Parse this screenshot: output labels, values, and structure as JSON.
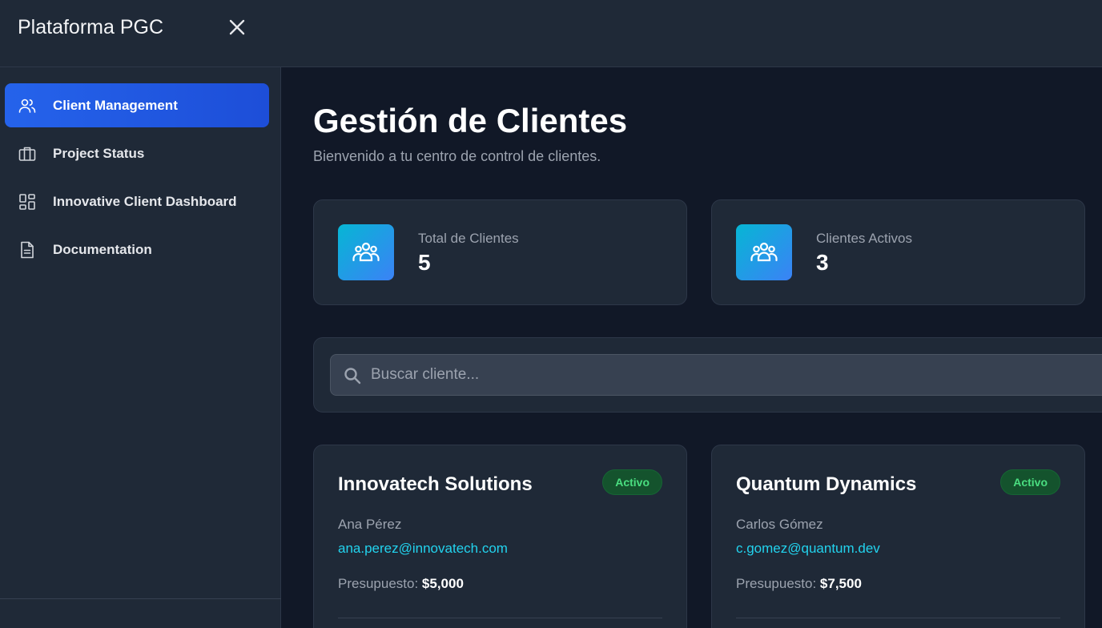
{
  "app": {
    "title": "Plataforma PGC"
  },
  "sidebar": {
    "items": [
      {
        "label": "Client Management",
        "icon": "users-icon",
        "active": true
      },
      {
        "label": "Project Status",
        "icon": "briefcase-icon",
        "active": false
      },
      {
        "label": "Innovative Client Dashboard",
        "icon": "dashboard-grid-icon",
        "active": false
      },
      {
        "label": "Documentation",
        "icon": "document-icon",
        "active": false
      }
    ]
  },
  "main": {
    "title": "Gestión de Clientes",
    "subtitle": "Bienvenido a tu centro de control de clientes.",
    "stats": [
      {
        "label": "Total de Clientes",
        "value": "5",
        "icon": "users-group-icon"
      },
      {
        "label": "Clientes Activos",
        "value": "3",
        "icon": "users-group-icon"
      }
    ],
    "search": {
      "placeholder": "Buscar cliente...",
      "value": ""
    },
    "clients": [
      {
        "name": "Innovatech Solutions",
        "status": "Activo",
        "contact": "Ana Pérez",
        "email": "ana.perez@innovatech.com",
        "budget_label": "Presupuesto:",
        "budget": "$5,000"
      },
      {
        "name": "Quantum Dynamics",
        "status": "Activo",
        "contact": "Carlos Gómez",
        "email": "c.gomez@quantum.dev",
        "budget_label": "Presupuesto:",
        "budget": "$7,500"
      }
    ]
  },
  "colors": {
    "accent": "#1d4ed8",
    "status_active": "#4ade80",
    "link": "#22d3ee",
    "background": "#111827",
    "panel": "#1f2937"
  }
}
